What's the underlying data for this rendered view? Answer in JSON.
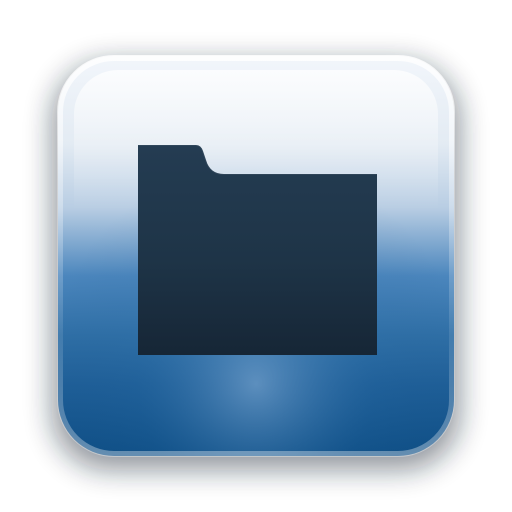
{
  "icon": {
    "name": "folder-icon",
    "colors": {
      "tile_top": "#e8eef5",
      "tile_mid": "#7fa7cf",
      "tile_blue": "#2f6fa6",
      "tile_bottom": "#0f4f86",
      "tile_shadow": "#0b1a2a",
      "folder_fill": "#22384b",
      "folder_fill_dark": "#162636"
    }
  }
}
